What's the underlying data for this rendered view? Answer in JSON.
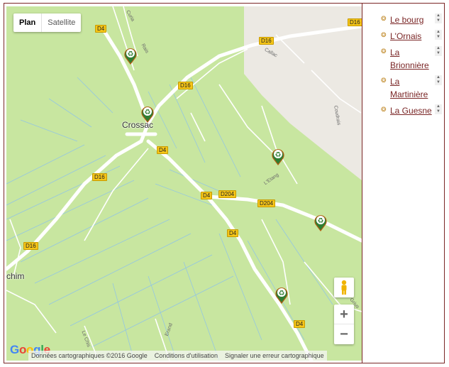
{
  "map_type": {
    "plan": "Plan",
    "satellite": "Satellite"
  },
  "roads": [
    {
      "id": "d4_top",
      "label": "D4"
    },
    {
      "id": "d16_top",
      "label": "D16"
    },
    {
      "id": "d16_far",
      "label": "D16"
    },
    {
      "id": "d16_mid",
      "label": "D16"
    },
    {
      "id": "d4_crossac",
      "label": "D4"
    },
    {
      "id": "d16_left",
      "label": "D16"
    },
    {
      "id": "d4_center",
      "label": "D4"
    },
    {
      "id": "d204_a",
      "label": "D204"
    },
    {
      "id": "d204_b",
      "label": "D204"
    },
    {
      "id": "d4_lower",
      "label": "D4"
    },
    {
      "id": "d16_lowleft",
      "label": "D16"
    },
    {
      "id": "d4_bottom",
      "label": "D4"
    }
  ],
  "towns": {
    "crossac": "Crossac",
    "chim": "chim"
  },
  "street_labels": {
    "curia": "Curia",
    "rais": "Rais",
    "callac": "Callac",
    "coudrais": "Coudrais",
    "letang": "L'Etang",
    "grius": "Grius",
    "erand": "Erand",
    "le_chis": "Le Chis"
  },
  "zoom": {
    "in": "+",
    "out": "−"
  },
  "attribution": {
    "data": "Données cartographiques ©2016 Google",
    "terms": "Conditions d'utilisation",
    "report": "Signaler une erreur cartographique"
  },
  "google_logo": {
    "letters": [
      "G",
      "o",
      "o",
      "g",
      "l",
      "e"
    ],
    "colors": [
      "#4285F4",
      "#EA4335",
      "#FBBC05",
      "#4285F4",
      "#34A853",
      "#EA4335"
    ]
  },
  "colors": {
    "land": "#c8e6a0",
    "urban": "#ece9e3",
    "road": "#ffffff",
    "water": "#8fc3e8",
    "marker": "#2e7d32",
    "link": "#7a2626"
  },
  "places": [
    {
      "name": "Le bourg"
    },
    {
      "name": "L'Ornais"
    },
    {
      "name": "La Brionnière"
    },
    {
      "name": "La Martinière"
    },
    {
      "name": "La Guesne"
    }
  ],
  "markers": [
    {
      "icon": "recycle-icon"
    },
    {
      "icon": "recycle-icon"
    },
    {
      "icon": "recycle-icon"
    },
    {
      "icon": "recycle-icon"
    },
    {
      "icon": "recycle-icon"
    }
  ]
}
